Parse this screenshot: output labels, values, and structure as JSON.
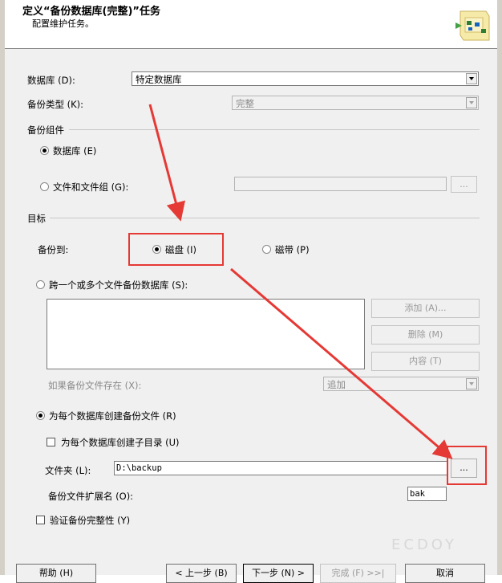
{
  "header": {
    "title": "定义“备份数据库(完整)”任务",
    "subtitle": "配置维护任务。"
  },
  "database": {
    "label": "数据库 (D):",
    "value": "特定数据库"
  },
  "backup_type": {
    "label": "备份类型 (K):",
    "value": "完整"
  },
  "backup_component": {
    "section": "备份组件",
    "database_label": "数据库 (E)",
    "files_label": "文件和文件组 (G):",
    "files_value": "",
    "browse_label": "..."
  },
  "target": {
    "section": "目标",
    "backup_to_label": "备份到:",
    "disk_label": "磁盘 (I)",
    "tape_label": "磁带 (P)"
  },
  "span_files": {
    "label": "跨一个或多个文件备份数据库 (S):",
    "add_button": "添加 (A)...",
    "remove_button": "删除 (M)",
    "contents_button": "内容 (T)",
    "if_exists_label": "如果备份文件存在 (X):",
    "if_exists_value": "追加"
  },
  "per_db": {
    "label": "为每个数据库创建备份文件 (R)",
    "subdir_label": "为每个数据库创建子目录 (U)",
    "folder_label": "文件夹 (L):",
    "folder_value": "D:\\backup",
    "folder_browse": "...",
    "extension_label": "备份文件扩展名 (O):",
    "extension_value": "bak"
  },
  "verify": {
    "label": "验证备份完整性 (Y)"
  },
  "footer": {
    "help": "帮助 (H)",
    "back": "< 上一步 (B)",
    "next": "下一步 (N) >",
    "finish": "完成 (F) >>|",
    "cancel": "取消"
  },
  "watermark": "ECDOY",
  "colors": {
    "annotation": "#e53935",
    "dialog_background": "#f0f0f0"
  }
}
